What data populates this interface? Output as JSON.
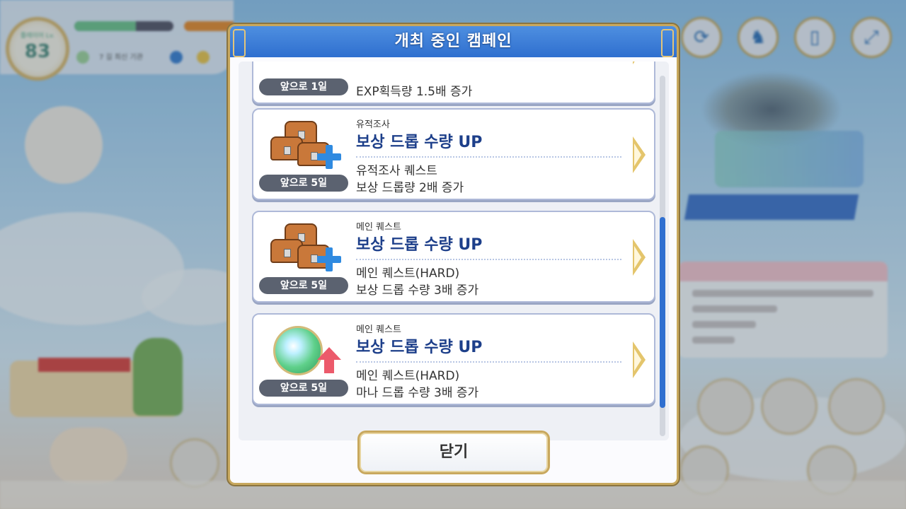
{
  "hud": {
    "level_label": "플레이어 Lv.",
    "level": "83",
    "exp_progress": 0.62,
    "info_text": "7 길 최신 기관"
  },
  "modal": {
    "title": "개최 중인 캠페인",
    "close_label": "닫기"
  },
  "campaigns": [
    {
      "remaining": "앞으로 1일",
      "detail1": "EXP획득량 1.5배 증가"
    },
    {
      "remaining": "앞으로 5일",
      "category": "유적조사",
      "headline": "보상 드롭 수량 UP",
      "detail1": "유적조사 퀘스트",
      "detail2": "보상 드롭량 2배 증가",
      "icon": "treasure-chest-plus"
    },
    {
      "remaining": "앞으로 5일",
      "category": "메인 퀘스트",
      "headline": "보상 드롭 수량 UP",
      "detail1": "메인 퀘스트(HARD)",
      "detail2": "보상 드롭 수량 3배 증가",
      "icon": "treasure-chest-plus"
    },
    {
      "remaining": "앞으로 5일",
      "category": "메인 퀘스트",
      "headline": "보상 드롭 수량 UP",
      "detail1": "메인 퀘스트(HARD)",
      "detail2": "마나 드롭 수량 3배 증가",
      "icon": "mana-orb-up"
    }
  ],
  "colors": {
    "header_blue": "#2f6fcf",
    "headline_navy": "#1d3f8a",
    "gold_border": "#c8a85e",
    "scroll_thumb": "#2f6fd0"
  }
}
